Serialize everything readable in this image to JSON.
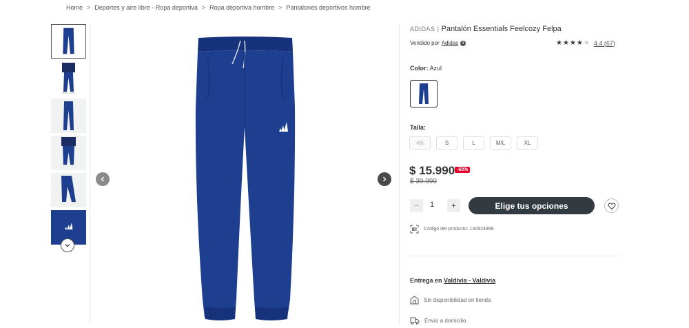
{
  "breadcrumb": {
    "items": [
      "Home",
      "Deportes y aire libre - Ropa deportiva",
      "Ropa deportiva hombre",
      "Pantalones deportivos hombre"
    ],
    "separator": ">"
  },
  "product": {
    "brand": "ADIDAS",
    "brand_separator": "|",
    "name": "Pantalón Essentials Feelcozy Felpa",
    "seller_prefix": "Vendido por",
    "seller_name": "Adidas",
    "rating_value": "4.4",
    "rating_count": "(67)",
    "stars_filled": 4,
    "stars_total": 5,
    "product_color": "#1e3f8f"
  },
  "color": {
    "label": "Color:",
    "value": "Azul"
  },
  "size": {
    "label": "Talla:",
    "options": [
      {
        "label": "XS",
        "available": false
      },
      {
        "label": "S",
        "available": true
      },
      {
        "label": "L",
        "available": true
      },
      {
        "label": "M/L",
        "available": true
      },
      {
        "label": "XL",
        "available": true
      }
    ]
  },
  "price": {
    "current": "$ 15.990",
    "discount_badge": "-60%",
    "original": "$ 39.990",
    "badge_color": "#e4002b"
  },
  "quantity": {
    "minus": "−",
    "value": "1",
    "plus": "+"
  },
  "cta": {
    "label": "Elige tus opciones",
    "color": "#333a40"
  },
  "product_code": {
    "label": "Código del producto: 140924996"
  },
  "delivery": {
    "prefix": "Entrega en",
    "location": "Valdivia - Valdivia",
    "store_pickup": "Sin disponibilidad en tienda",
    "home_delivery": "Envío a domicilio"
  },
  "icons": {
    "thumb_down": "chevron-down-icon",
    "prev": "chevron-left-icon",
    "next": "chevron-right-icon",
    "info": "info-icon",
    "wishlist": "heart-icon",
    "code": "barcode-icon",
    "store": "store-icon",
    "truck": "truck-icon"
  }
}
